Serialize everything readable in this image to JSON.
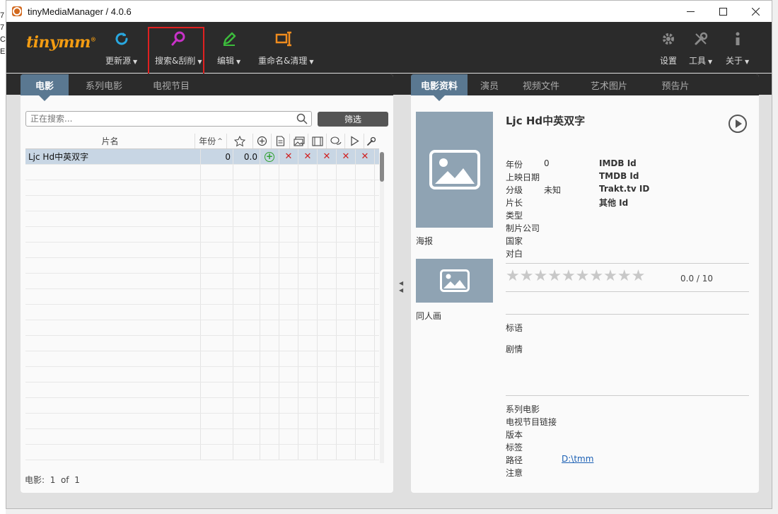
{
  "desk_strip": [
    "7",
    "7",
    "C",
    "E"
  ],
  "window": {
    "title": "tinyMediaManager / 4.0.6"
  },
  "toolbar": {
    "logo": "tinymm",
    "logo_mark": "®",
    "buttons": [
      {
        "label": "更新源",
        "icon": "refresh-icon",
        "color": "#29a8e0"
      },
      {
        "label": "搜索&刮削",
        "icon": "search-icon",
        "color": "#c832c8"
      },
      {
        "label": "编辑",
        "icon": "pencil-icon",
        "color": "#3cbc3c"
      },
      {
        "label": "重命名&清理",
        "icon": "rename-icon",
        "color": "#f08c1e"
      }
    ],
    "right_buttons": [
      {
        "label": "设置",
        "icon": "gear-icon"
      },
      {
        "label": "工具",
        "icon": "wrench-icon"
      },
      {
        "label": "关于",
        "icon": "info-icon"
      }
    ]
  },
  "left": {
    "tabs": [
      "电影",
      "系列电影",
      "电视节目"
    ],
    "active_tab": 0,
    "search_placeholder": "正在搜索...",
    "filter_label": "筛选",
    "columns": {
      "title": "片名",
      "year": "年份"
    },
    "rows": [
      {
        "title": "Ljc Hd中英双字",
        "year": "0",
        "rating": "0.0"
      }
    ],
    "status": {
      "label": "电影:",
      "current": "1",
      "of": "of",
      "total": "1"
    }
  },
  "right": {
    "tabs": [
      "电影资料",
      "演员",
      "视频文件",
      "艺术图片",
      "预告片"
    ],
    "active_tab": 0,
    "movie_title": "Ljc Hd中英双字",
    "poster_caption": "海报",
    "fanart_caption": "同人画",
    "fields_left": [
      {
        "label": "年份",
        "value": "0"
      },
      {
        "label": "上映日期",
        "value": ""
      },
      {
        "label": "分级",
        "value": "未知"
      },
      {
        "label": "片长",
        "value": ""
      },
      {
        "label": "类型",
        "value": ""
      },
      {
        "label": "制片公司",
        "value": ""
      },
      {
        "label": "国家",
        "value": ""
      },
      {
        "label": "对白",
        "value": ""
      }
    ],
    "fields_ids": [
      "IMDB Id",
      "TMDB Id",
      "Trakt.tv ID",
      "其他 Id"
    ],
    "rating_text": "0.0 / 10",
    "tagline_label": "标语",
    "plot_label": "剧情",
    "fields_bottom": [
      {
        "label": "系列电影",
        "value": ""
      },
      {
        "label": "电视节目链接",
        "value": ""
      },
      {
        "label": "版本",
        "value": ""
      },
      {
        "label": "标签",
        "value": ""
      },
      {
        "label": "路径",
        "value": "D:\\tmm"
      },
      {
        "label": "注意",
        "value": ""
      }
    ]
  }
}
